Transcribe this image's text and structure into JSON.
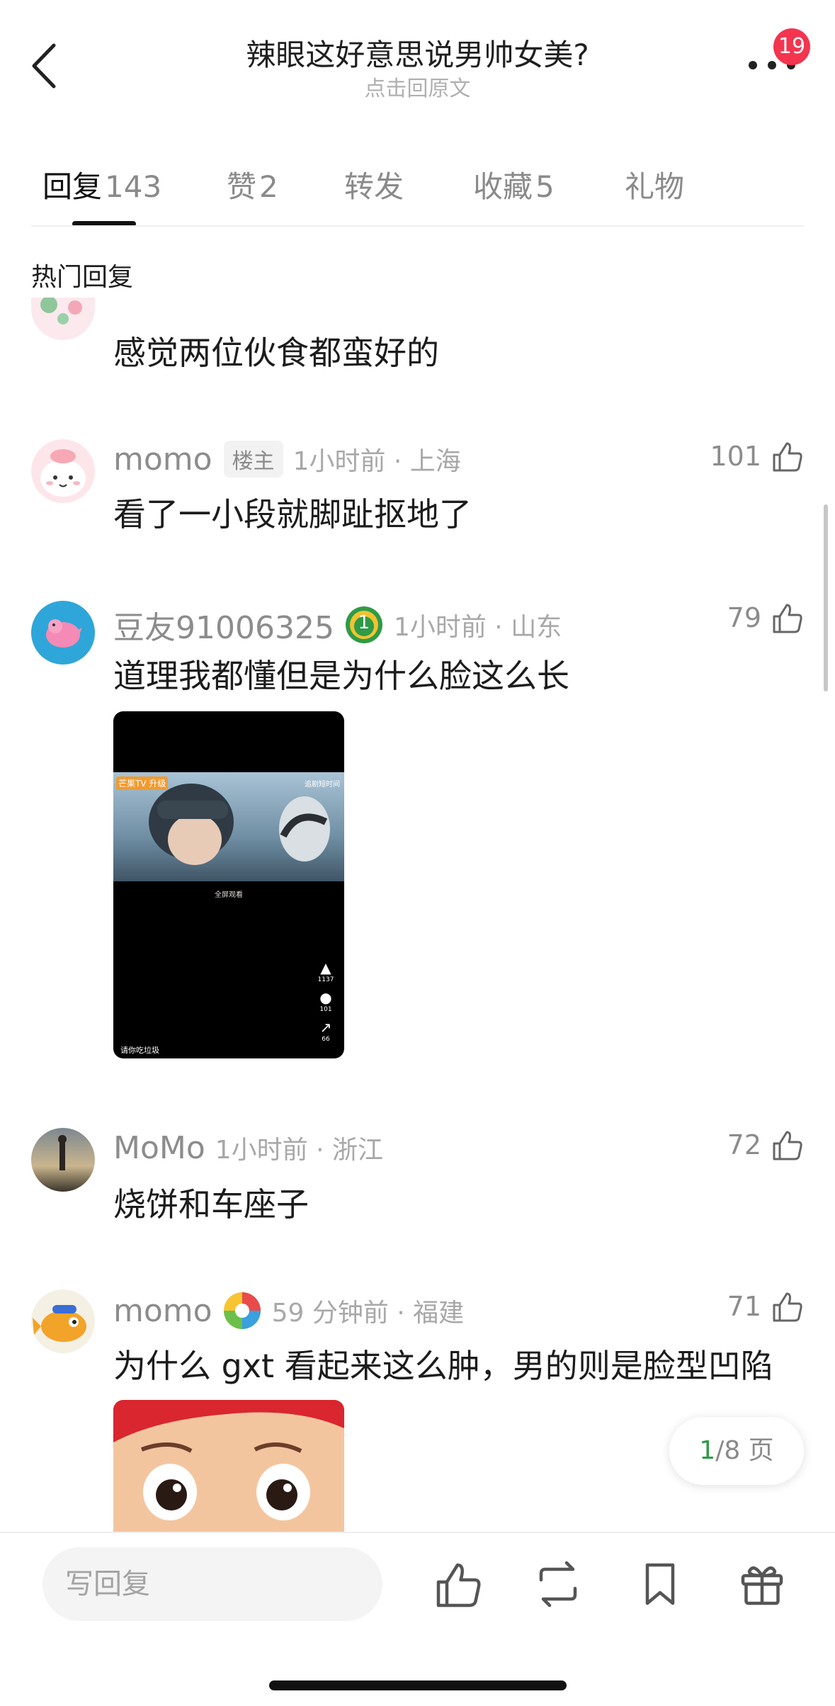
{
  "header": {
    "title": "辣眼这好意思说男帅女美?",
    "subtitle": "点击回原文",
    "notification_count": "19",
    "icons": {
      "back": "chevron-left-icon",
      "more": "more-dots-icon"
    }
  },
  "tabs": [
    {
      "label": "回复",
      "count": "143",
      "active": true
    },
    {
      "label": "赞",
      "count": "2"
    },
    {
      "label": "转发",
      "count": ""
    },
    {
      "label": "收藏",
      "count": "5"
    },
    {
      "label": "礼物",
      "count": ""
    }
  ],
  "section_title": "热门回复",
  "comments": [
    {
      "text": "感觉两位伙食都蛮好的"
    },
    {
      "user": "momo",
      "tag": "楼主",
      "time": "1小时前 · 上海",
      "likes": "101",
      "text": "看了一小段就脚趾抠地了"
    },
    {
      "user": "豆友91006325",
      "badge": "1",
      "time": "1小时前 · 山东",
      "likes": "79",
      "text": "道理我都懂但是为什么脸这么长",
      "image": {
        "overlay_tag": "芒果TV 升级",
        "watermark": "追剧短时间",
        "fullscreen_label": "全屏观看",
        "like_count": "1137",
        "comment_count": "101",
        "share_count": "66",
        "caption": "请你吃垃圾"
      }
    },
    {
      "user": "MoMo",
      "time": "1小时前 · 浙江",
      "likes": "72",
      "text": "烧饼和车座子"
    },
    {
      "user": "momo",
      "time": "59 分钟前 · 福建",
      "likes": "71",
      "text": "为什么 gxt 看起来这么肿，男的则是脸型凹陷"
    }
  ],
  "pager": {
    "current": "1",
    "total_text": "/8 页"
  },
  "bottom_bar": {
    "reply_placeholder": "写回复",
    "icons": [
      "thumbs-up-icon",
      "repost-icon",
      "bookmark-icon",
      "gift-icon"
    ]
  }
}
